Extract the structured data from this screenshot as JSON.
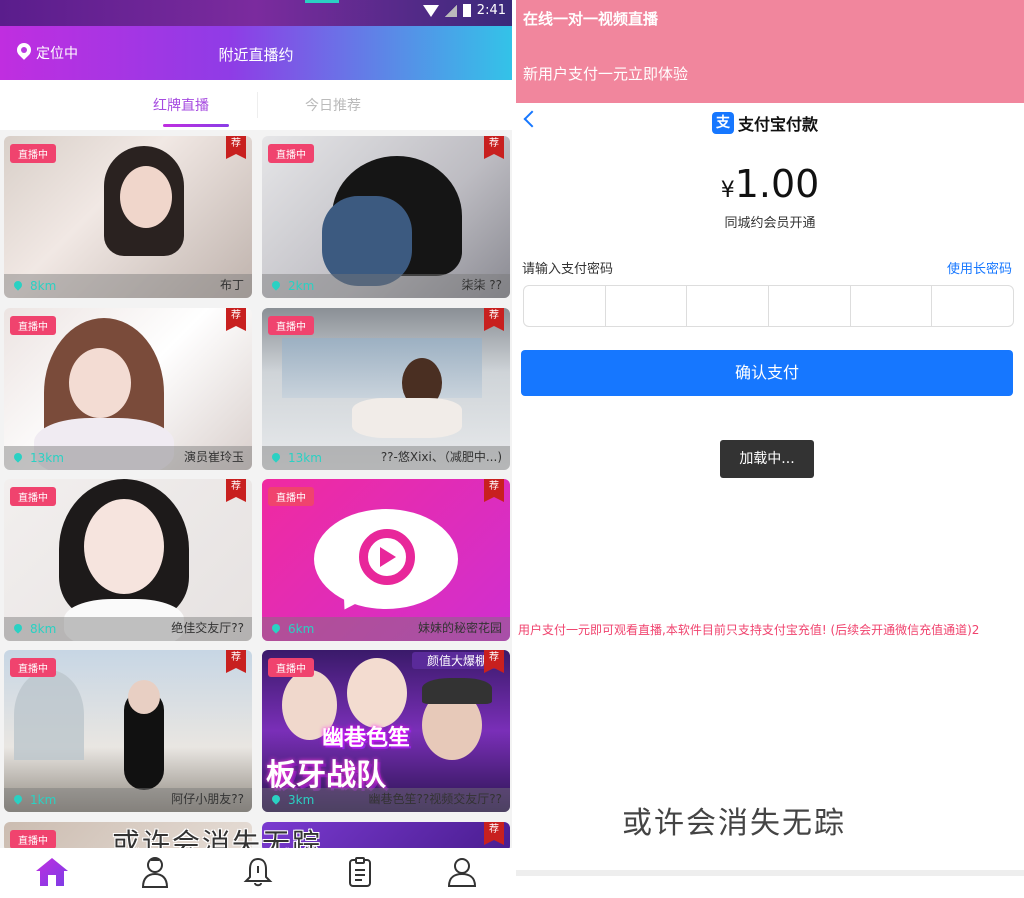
{
  "left": {
    "status": {
      "time": "2:41"
    },
    "appbar": {
      "location": "定位中",
      "title": "附近直播约"
    },
    "tabs": [
      {
        "label": "红牌直播",
        "active": true
      },
      {
        "label": "今日推荐",
        "active": false
      }
    ],
    "live_badge": "直播中",
    "rec_badge": "荐",
    "cards": [
      {
        "distance": "8km",
        "name": "布丁"
      },
      {
        "distance": "2km",
        "name": "柒柒 ??"
      },
      {
        "distance": "13km",
        "name": "演员崔玲玉"
      },
      {
        "distance": "13km",
        "name": "??-悠Xixi、（减肥中...)"
      },
      {
        "distance": "8km",
        "name": "绝佳交友厅??"
      },
      {
        "distance": "6km",
        "name": "妹妹的秘密花园"
      },
      {
        "distance": "1km",
        "name": "阿仔小朋友??"
      },
      {
        "distance": "3km",
        "name": "幽巷色笙??视频交友厅??"
      }
    ],
    "banner_text_1": "幽巷色笙",
    "banner_text_2": "板牙战队",
    "banner_text_3": "颜值大爆棚",
    "watermark": "或许会消失无踪",
    "nav": [
      {
        "icon": "home-icon"
      },
      {
        "icon": "doctor-icon"
      },
      {
        "icon": "bell-icon"
      },
      {
        "icon": "clipboard-icon"
      },
      {
        "icon": "user-icon"
      }
    ],
    "colors": {
      "accent": "#a64be0",
      "live": "#f0436e",
      "distance": "#2ad1c3"
    }
  },
  "right": {
    "header": {
      "line1": "在线一对一视频直播",
      "line2": "新用户支付一元立即体验"
    },
    "pay": {
      "logo_char": "支",
      "title": "支付宝付款",
      "currency": "¥",
      "amount": "1.00",
      "subtitle": "同城约会员开通",
      "pwd_label": "请输入支付密码",
      "long_pwd": "使用长密码",
      "confirm": "确认支付",
      "loading": "加载中..."
    },
    "notice": "用户支付一元即可观看直播,本软件目前只支持支付宝充值! (后续会开通微信充值通道)2",
    "watermark": "或许会消失无踪",
    "colors": {
      "header": "#f1869d",
      "primary": "#1677ff"
    }
  }
}
